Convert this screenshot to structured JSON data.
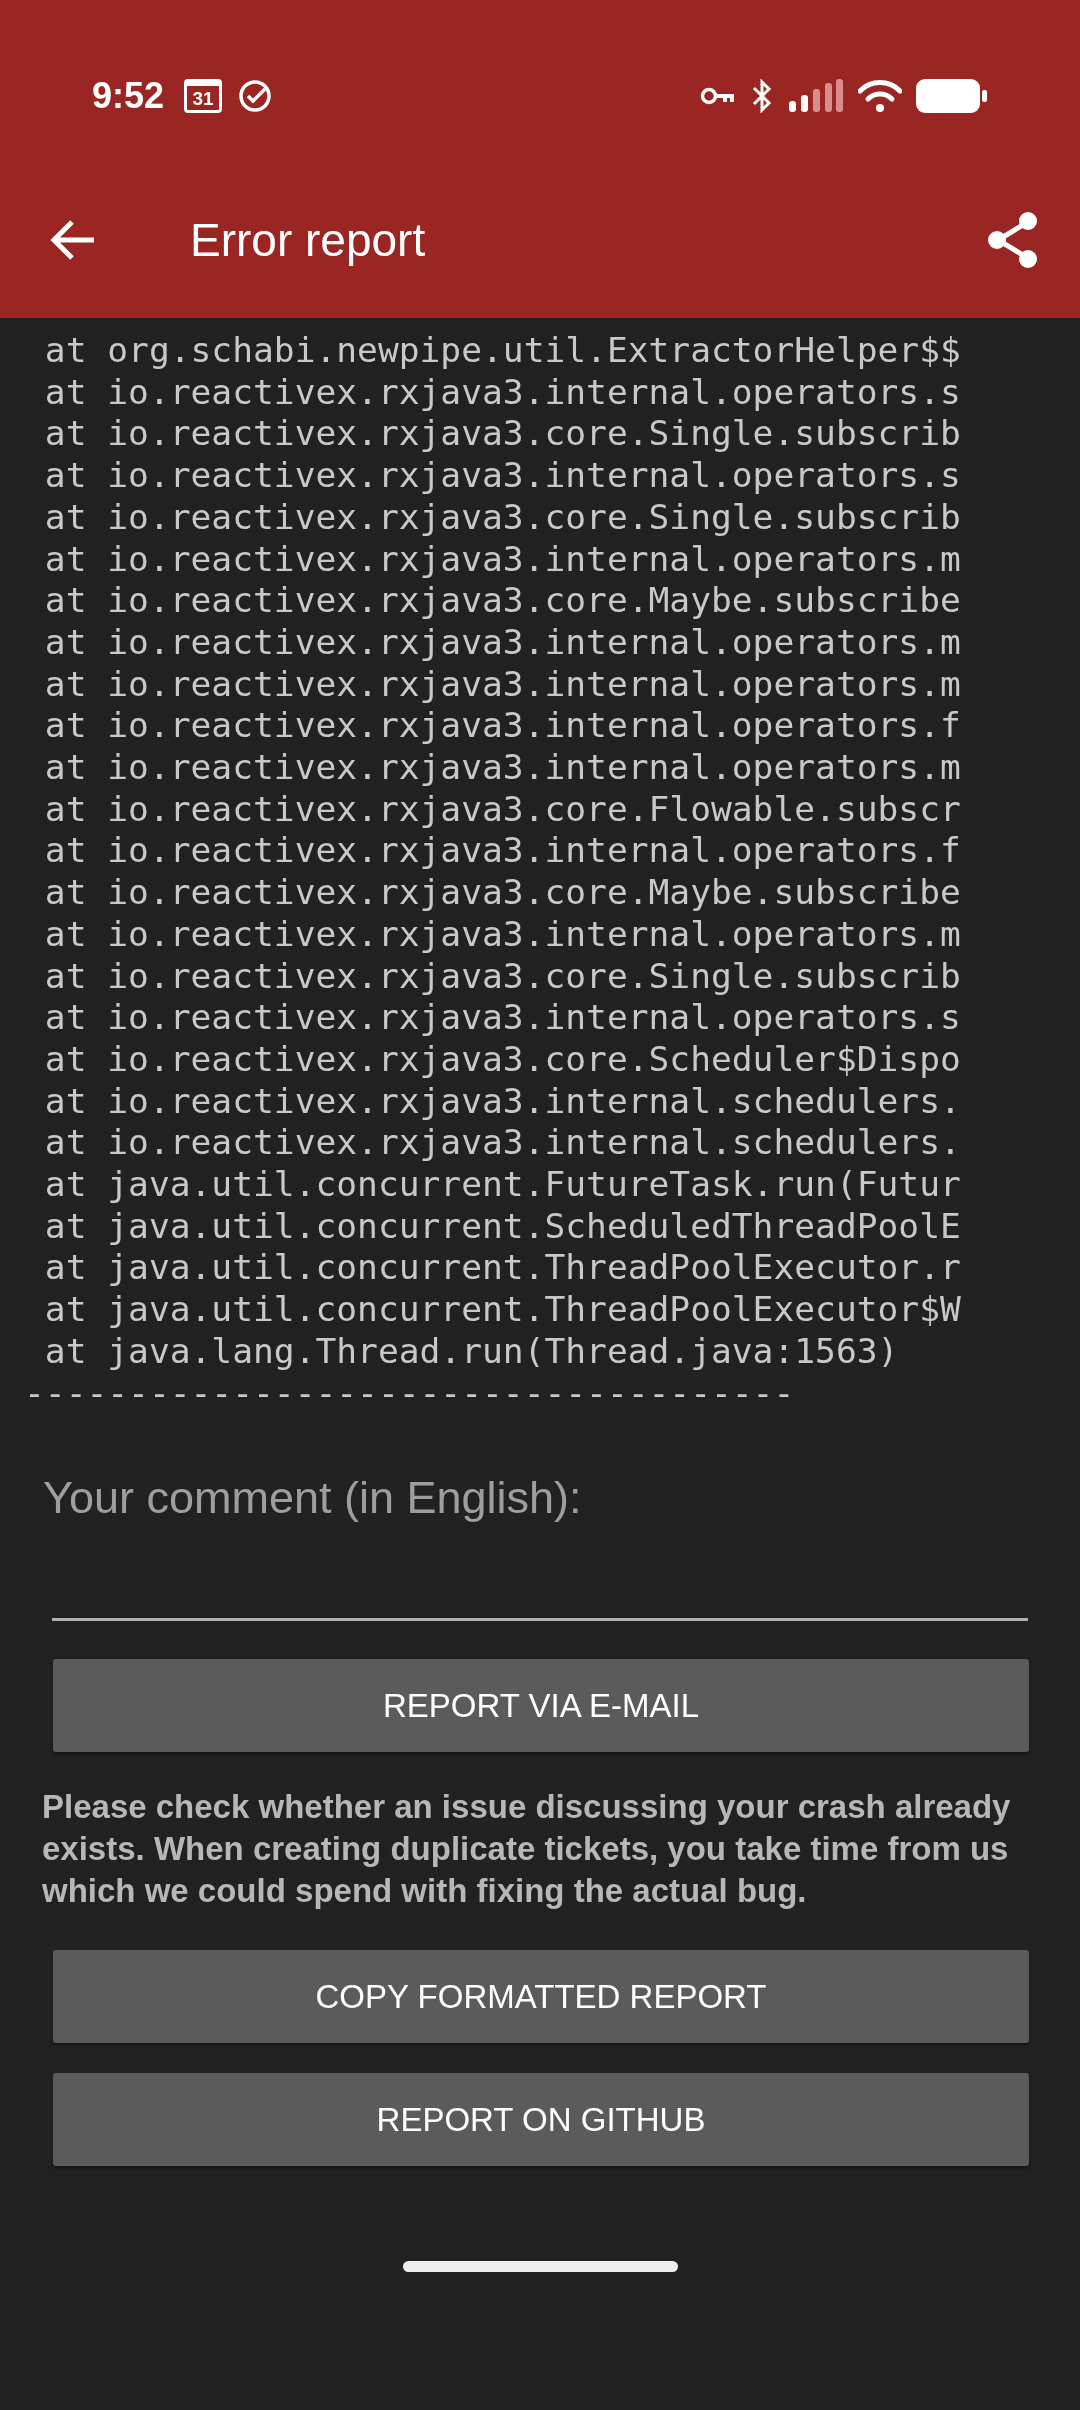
{
  "status_bar": {
    "time": "9:52",
    "calendar_day": "31"
  },
  "app_bar": {
    "title": "Error report"
  },
  "stack_trace": [
    " at org.schabi.newpipe.util.ExtractorHelper$$",
    " at io.reactivex.rxjava3.internal.operators.s",
    " at io.reactivex.rxjava3.core.Single.subscrib",
    " at io.reactivex.rxjava3.internal.operators.s",
    " at io.reactivex.rxjava3.core.Single.subscrib",
    " at io.reactivex.rxjava3.internal.operators.m",
    " at io.reactivex.rxjava3.core.Maybe.subscribe",
    " at io.reactivex.rxjava3.internal.operators.m",
    " at io.reactivex.rxjava3.internal.operators.m",
    " at io.reactivex.rxjava3.internal.operators.f",
    " at io.reactivex.rxjava3.internal.operators.m",
    " at io.reactivex.rxjava3.core.Flowable.subscr",
    " at io.reactivex.rxjava3.internal.operators.f",
    " at io.reactivex.rxjava3.core.Maybe.subscribe",
    " at io.reactivex.rxjava3.internal.operators.m",
    " at io.reactivex.rxjava3.core.Single.subscrib",
    " at io.reactivex.rxjava3.internal.operators.s",
    " at io.reactivex.rxjava3.core.Scheduler$Dispo",
    " at io.reactivex.rxjava3.internal.schedulers.",
    " at io.reactivex.rxjava3.internal.schedulers.",
    " at java.util.concurrent.FutureTask.run(Futur",
    " at java.util.concurrent.ScheduledThreadPoolE",
    " at java.util.concurrent.ThreadPoolExecutor.r",
    " at java.util.concurrent.ThreadPoolExecutor$W",
    " at java.lang.Thread.run(Thread.java:1563)",
    "-------------------------------------"
  ],
  "comment_field": {
    "label": "Your comment (in English):"
  },
  "buttons_top": [
    "REPORT VIA E-MAIL"
  ],
  "notice": "Please check whether an issue discussing your crash already exists. When creating duplicate tickets, you take time from us which we could spend with fixing the actual bug.",
  "buttons_bottom": [
    "COPY FORMATTED REPORT",
    "REPORT ON GITHUB"
  ]
}
